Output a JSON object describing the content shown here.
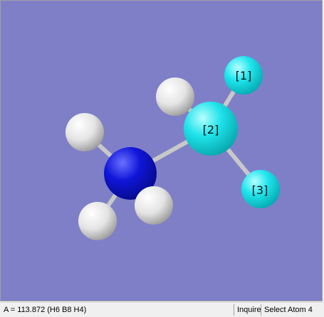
{
  "viewport": {
    "background_color": "#7f7fc8",
    "atom_labels": {
      "atom1": "[1]",
      "atom2": "[2]",
      "atom3": "[3]"
    },
    "colors": {
      "hydrogen": "#ffffff",
      "fluorine": "#00e5ea",
      "nitrogen": "#0a10d2",
      "bond": "#d0d0d0"
    }
  },
  "statusbar": {
    "measurement": "A = 113.872 (H6 B8 H4)",
    "mode": "Inquire",
    "prompt": "Select Atom 4"
  }
}
